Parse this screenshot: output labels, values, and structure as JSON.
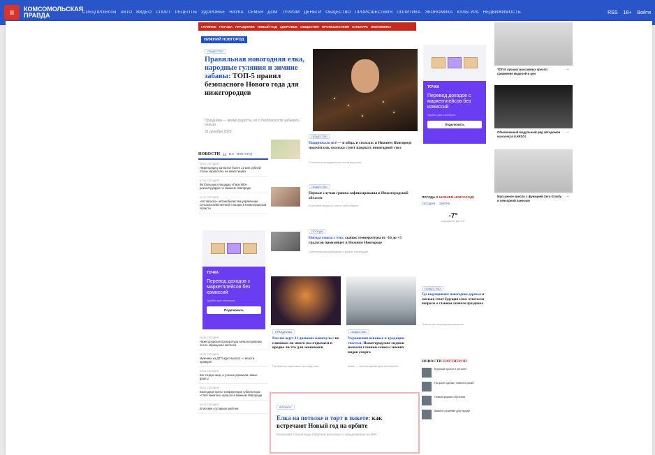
{
  "topbar": {
    "logo": "КОМСОМОЛЬСКАЯ ПРАВДА",
    "nav": [
      "СПЕЦПРОЕКТЫ",
      "АВТО",
      "ВИДЕО",
      "СПОРТ",
      "РЕЦЕПТЫ",
      "ЗДОРОВЬЕ",
      "НАУКА",
      "СЕМЬЯ",
      "ДОМ",
      "ТУРИЗМ",
      "ДЕНЬГИ",
      "ОБЩЕСТВО",
      "ПРОИСШЕСТВИЯ",
      "ПОЛИТИКА",
      "ЭКОНОМИКА",
      "КУЛЬТУРА",
      "НЕДВИЖИМОСТЬ"
    ],
    "right": [
      "RSS",
      "18+",
      "Войти"
    ]
  },
  "redbar": [
    "ГЛАВНОЕ",
    "ПОГОДА",
    "ПРАЗДНИКИ",
    "НОВЫЙ ГОД",
    "ЗДОРОВЬЕ",
    "ОБЩЕСТВО",
    "ПРОИСШЕСТВИЯ",
    "КУЛЬТУРА",
    "ЭКОНОМИКА"
  ],
  "city": "НИЖНИЙ НОВГОРОД",
  "hero": {
    "tag": "ОБЩЕСТВО",
    "title_blue": "Правильная новогодняя елка, народные гуляния и зимние забавы:",
    "title_black": "ТОП-5 правил безопасного Нового года для нижегородцев",
    "sub": "Праздники — время радости, но о безопасности забывать нельзя",
    "date": "31 декабря 2023",
    "caption": "Фото: архив КП"
  },
  "news": {
    "title": "НОВОСТИ",
    "count": "24",
    "tab1": "ВСЕ",
    "tab2": "МОЙ ГОРОД",
    "items": [
      {
        "time": "08:00 СЕГОДНЯ",
        "text": "Нижегородец заплатил более 11 млн рублей, чтобы заработать на инвестициях"
      },
      {
        "time": "07:35 СЕГОДНЯ",
        "text": "Футбольную площадку «Парк 800» реконструируют в Нижнем Новгороде"
      },
      {
        "time": "07:12 СЕГОДНЯ",
        "text": "«Кстовского» автомобилистам управление сельскохозяйственной станции в Нижегородской области"
      }
    ],
    "items2": [
      {
        "time": "06:48 СЕГОДНЯ",
        "text": "Нижегородская прокуратура начала проверку после обращения жителей"
      },
      {
        "time": "06:20 СЕГОДНЯ",
        "text": "Мужчина из ДТП ждет выплат — власти проверят"
      },
      {
        "time": "05:54 СЕГОДНЯ",
        "text": "Бог создал мир, а ученые доказали новые факты"
      },
      {
        "time": "05:31 СЕГОДНЯ",
        "text": "Ежегодная пресс-конференция губернатора «Глеб Никитин» прошла в Нижнем Новгороде"
      },
      {
        "time": "05:10 СЕГОДНЯ",
        "text": "В Москве составили рейтинг"
      }
    ]
  },
  "promo": {
    "brand": "ТОЧКА",
    "title": "Перевод доходов с маркетплейсов без комиссий",
    "sub": "Удобно для селлеров",
    "button": "Подключить"
  },
  "cards": [
    {
      "tag": "ОБЩЕСТВО",
      "hl": "Подорожало всё",
      "title": " — и яйца, и сосиски: в Нижнем Новгороде подсчитали, сколько стоит накрыть новогодний стол",
      "desc": "Стоимость праздничного стола выросла"
    },
    {
      "tag": "ОБЩЕСТВО",
      "hl": "",
      "title": "Первые случаи гриппа зафиксированы в Нижегородской области",
      "desc": "В регионе выросло число заболевших"
    },
    {
      "tag": "ПОГОДА",
      "hl": "Погода сошла с ума:",
      "title": " скачок температуры от -16 до +5 градусов произойдет в Нижнем Новгороде",
      "desc": "Синоптики предупредили о резких перепадах"
    }
  ],
  "mid": [
    {
      "tag": "ПРАЗДНИКИ",
      "hl": "Россия ждут 11 дневные каникулы:",
      "title": " не слишком ли много мы отдыхаем и вредно ли это для экономики",
      "desc": "Профессор оценивает последствия"
    },
    {
      "tag": "ОБЩЕСТВО",
      "hl": "Украшения вековые и традиции счастья:",
      "title": " Нижегородские медики назвали главные плюсы зимних видов спорта",
      "desc": "Зима — лучшее время для активности"
    }
  ],
  "big": {
    "tag": "КОСМОС",
    "hl": "Елка на потолке и торт в пакете:",
    "title": " как встречают Новый год на орбите",
    "desc": "Космонавт Сергей Кудь-Сверчков рассказал о праздновании на МКС"
  },
  "weather": {
    "title": "ПОГОДА",
    "city": "В НИЖНЕМ НОВГОРОДЕ",
    "today": "СЕГОДНЯ",
    "tomorrow": "ЗАВТРА",
    "temp": "-7°",
    "feels": "ощущается как -12°"
  },
  "question": {
    "tag": "ОБЩЕСТВО",
    "hl": "Где выращивают новогодние деревья",
    "title": " и сколько стоит будущая елка: ответы на вопросы о главном символе праздника",
    "desc": "Ответы на популярные вопросы"
  },
  "partners": {
    "title": "НОВОСТИ",
    "title_red": "ПАРТНЕРОВ",
    "items": [
      "Крупный проект в регионе",
      "На фоне сделки, новости рынка",
      "Новый формат обучения",
      "Важное решение для города"
    ]
  },
  "ads": [
    {
      "text": "ТОП-5 лучших массажных кресел: сравнение моделей и цен"
    },
    {
      "text": "Обновленный модульный ряд автодомов на колесах KARSO!"
    },
    {
      "text": "Массажное кресло с функцией Zero Gravity и сенсорной панелью"
    }
  ]
}
